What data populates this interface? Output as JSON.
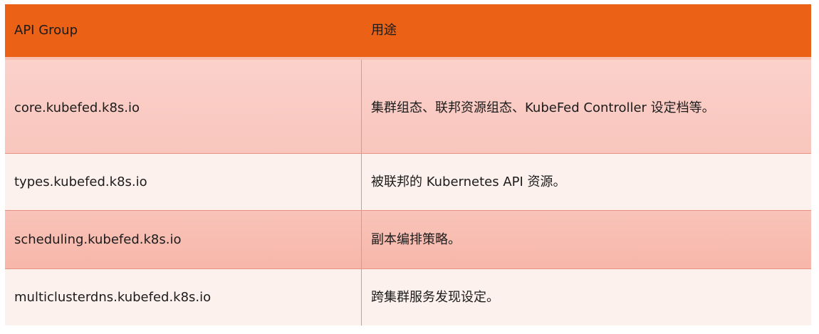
{
  "table": {
    "headers": [
      "API Group",
      "用途"
    ],
    "rows": [
      {
        "group": "core.kubefed.k8s.io",
        "purpose": "集群组态、联邦资源组态、KubeFed Controller 设定档等。"
      },
      {
        "group": "types.kubefed.k8s.io",
        "purpose": "被联邦的 Kubernetes API 资源。"
      },
      {
        "group": "scheduling.kubefed.k8s.io",
        "purpose": "副本编排策略。"
      },
      {
        "group": "multiclusterdns.kubefed.k8s.io",
        "purpose": "跨集群服务发现设定。"
      }
    ]
  },
  "colors": {
    "header_bg": "#eb6115",
    "header_text": "#ffffff",
    "row_pink": "#f8c6bd",
    "row_light": "#fdf1ee",
    "border": "#e89284"
  }
}
